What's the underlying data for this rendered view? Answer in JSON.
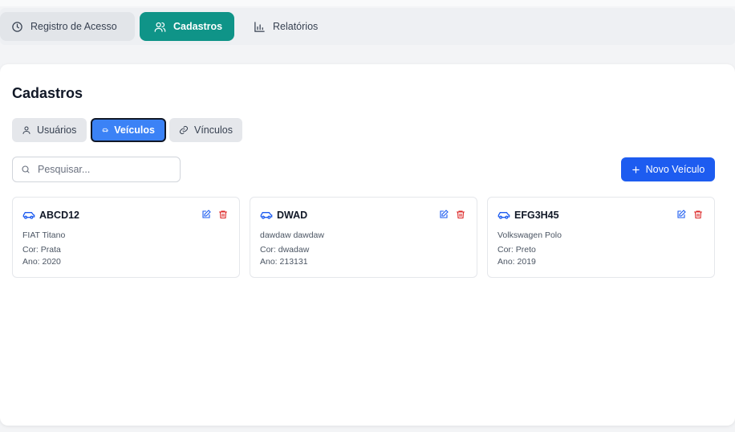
{
  "nav": {
    "tabs": [
      {
        "label": "Registro de Acesso",
        "icon": "clock-icon"
      },
      {
        "label": "Cadastros",
        "icon": "users-icon",
        "active": true
      },
      {
        "label": "Relatórios",
        "icon": "bar-chart-icon"
      }
    ]
  },
  "page": {
    "title": "Cadastros",
    "subtabs": [
      {
        "label": "Usuários",
        "icon": "user-icon"
      },
      {
        "label": "Veículos",
        "icon": "car-icon",
        "active": true
      },
      {
        "label": "Vínculos",
        "icon": "link-icon"
      }
    ],
    "search_placeholder": "Pesquisar...",
    "new_button": "Novo Veículo"
  },
  "vehicles": [
    {
      "plate": "ABCD12",
      "model": "FIAT Titano",
      "cor": "Cor: Prata",
      "ano": "Ano: 2020"
    },
    {
      "plate": "DWAD",
      "model": "dawdaw dawdaw",
      "cor": "Cor: dwadaw",
      "ano": "Ano: 213131"
    },
    {
      "plate": "EFG3H45",
      "model": "Volkswagen Polo",
      "cor": "Cor: Preto",
      "ano": "Ano: 2019"
    }
  ],
  "colors": {
    "teal": "#0f9488",
    "blue": "#3b82f6",
    "primary": "#1d5cf0",
    "danger": "#dc2626"
  }
}
